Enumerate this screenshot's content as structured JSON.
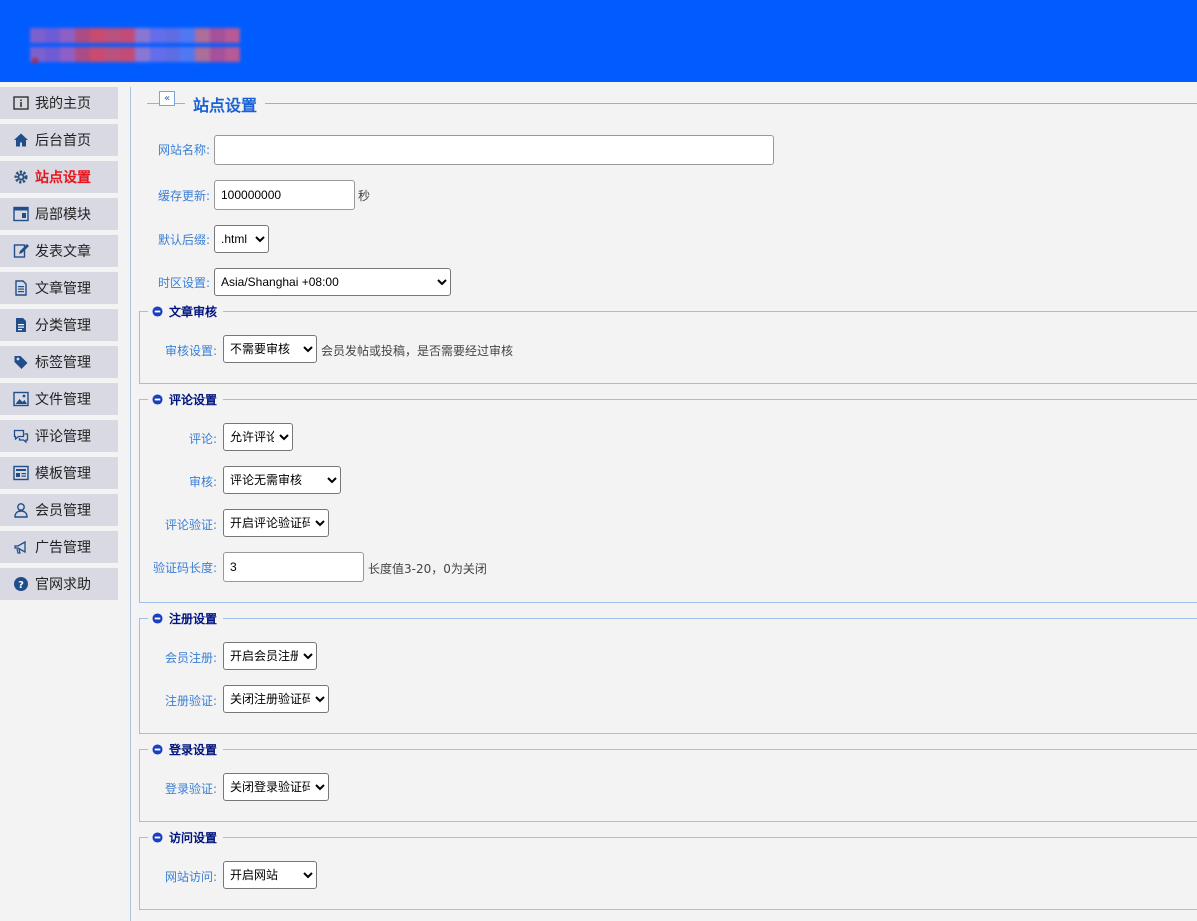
{
  "colors": {
    "header": "#005cff",
    "active_menu": "#e8151b",
    "label": "#3a7fd5",
    "legend": "#00157f"
  },
  "sidebar": {
    "items": [
      {
        "label": "我的主页",
        "icon": "info-icon"
      },
      {
        "label": "后台首页",
        "icon": "home-icon"
      },
      {
        "label": "站点设置",
        "icon": "gear-icon",
        "active": true
      },
      {
        "label": "局部模块",
        "icon": "window-icon"
      },
      {
        "label": "发表文章",
        "icon": "edit-icon"
      },
      {
        "label": "文章管理",
        "icon": "document-icon"
      },
      {
        "label": "分类管理",
        "icon": "file-icon"
      },
      {
        "label": "标签管理",
        "icon": "tag-icon"
      },
      {
        "label": "文件管理",
        "icon": "image-icon"
      },
      {
        "label": "评论管理",
        "icon": "comment-icon"
      },
      {
        "label": "模板管理",
        "icon": "template-icon"
      },
      {
        "label": "会员管理",
        "icon": "user-icon"
      },
      {
        "label": "广告管理",
        "icon": "megaphone-icon"
      },
      {
        "label": "官网求助",
        "icon": "help-icon"
      }
    ]
  },
  "page": {
    "collapse_glyph": "«",
    "title": "站点设置"
  },
  "basic": {
    "site_name_label": "网站名称:",
    "site_name_value": "",
    "cache_label": "缓存更新:",
    "cache_value": "100000000",
    "cache_unit": "秒",
    "suffix_label": "默认后缀:",
    "suffix_value": ".html",
    "timezone_label": "时区设置:",
    "timezone_value": "Asia/Shanghai +08:00"
  },
  "review": {
    "legend": "文章审核",
    "label": "审核设置:",
    "value": "不需要审核",
    "note": "会员发帖或投稿，是否需要经过审核"
  },
  "comment": {
    "legend": "评论设置",
    "comment_label": "评论:",
    "comment_value": "允许评论",
    "audit_label": "审核:",
    "audit_value": "评论无需审核",
    "verify_label": "评论验证:",
    "verify_value": "开启评论验证码",
    "code_len_label": "验证码长度:",
    "code_len_value": "3",
    "code_len_note": "长度值3-20，0为关闭"
  },
  "register": {
    "legend": "注册设置",
    "member_label": "会员注册:",
    "member_value": "开启会员注册",
    "verify_label": "注册验证:",
    "verify_value": "关闭注册验证码"
  },
  "login": {
    "legend": "登录设置",
    "verify_label": "登录验证:",
    "verify_value": "关闭登录验证码"
  },
  "access": {
    "legend": "访问设置",
    "label": "网站访问:",
    "value": "开启网站"
  }
}
